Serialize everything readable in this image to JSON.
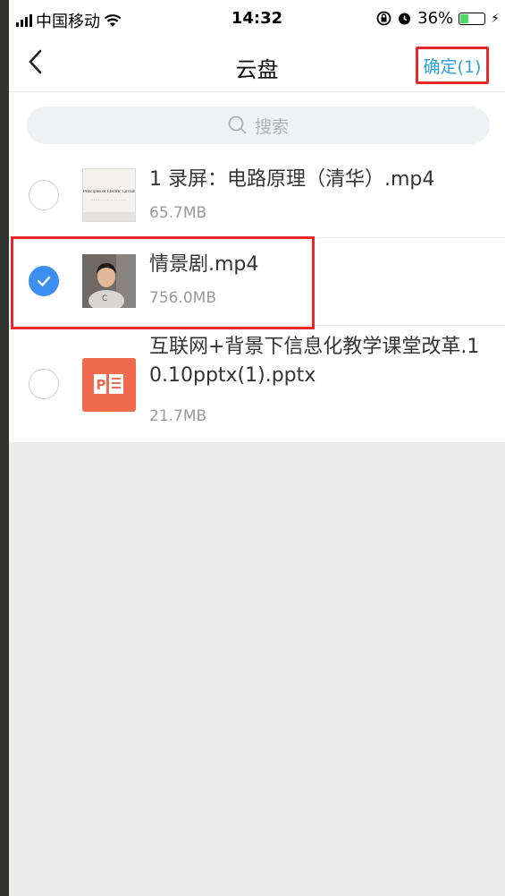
{
  "status_bar": {
    "carrier": "中国移动",
    "time": "14:32",
    "battery_percent": "36%",
    "battery_level": 0.36
  },
  "nav": {
    "title": "云盘",
    "confirm_label": "确定(1)"
  },
  "search": {
    "placeholder": "搜索"
  },
  "files": [
    {
      "name": "1 录屏：电路原理（清华）.mp4",
      "size": "65.7MB",
      "checked": false,
      "thumb_text": "Principles of Electric Circuits",
      "thumb_subtext": "· · · · · · · · · · · · · · · ·",
      "icon": "video-thumbnail"
    },
    {
      "name": "情景剧.mp4",
      "size": "756.0MB",
      "checked": true,
      "icon": "video-thumbnail-person"
    },
    {
      "name": "互联网+背景下信息化教学课堂改革.10.10pptx(1).pptx",
      "size": "21.7MB",
      "checked": false,
      "icon": "powerpoint-icon"
    }
  ],
  "colors": {
    "accent": "#2aa1db",
    "check": "#3c8ff0",
    "highlight": "#e8282b",
    "ppt": "#f06a4f"
  }
}
